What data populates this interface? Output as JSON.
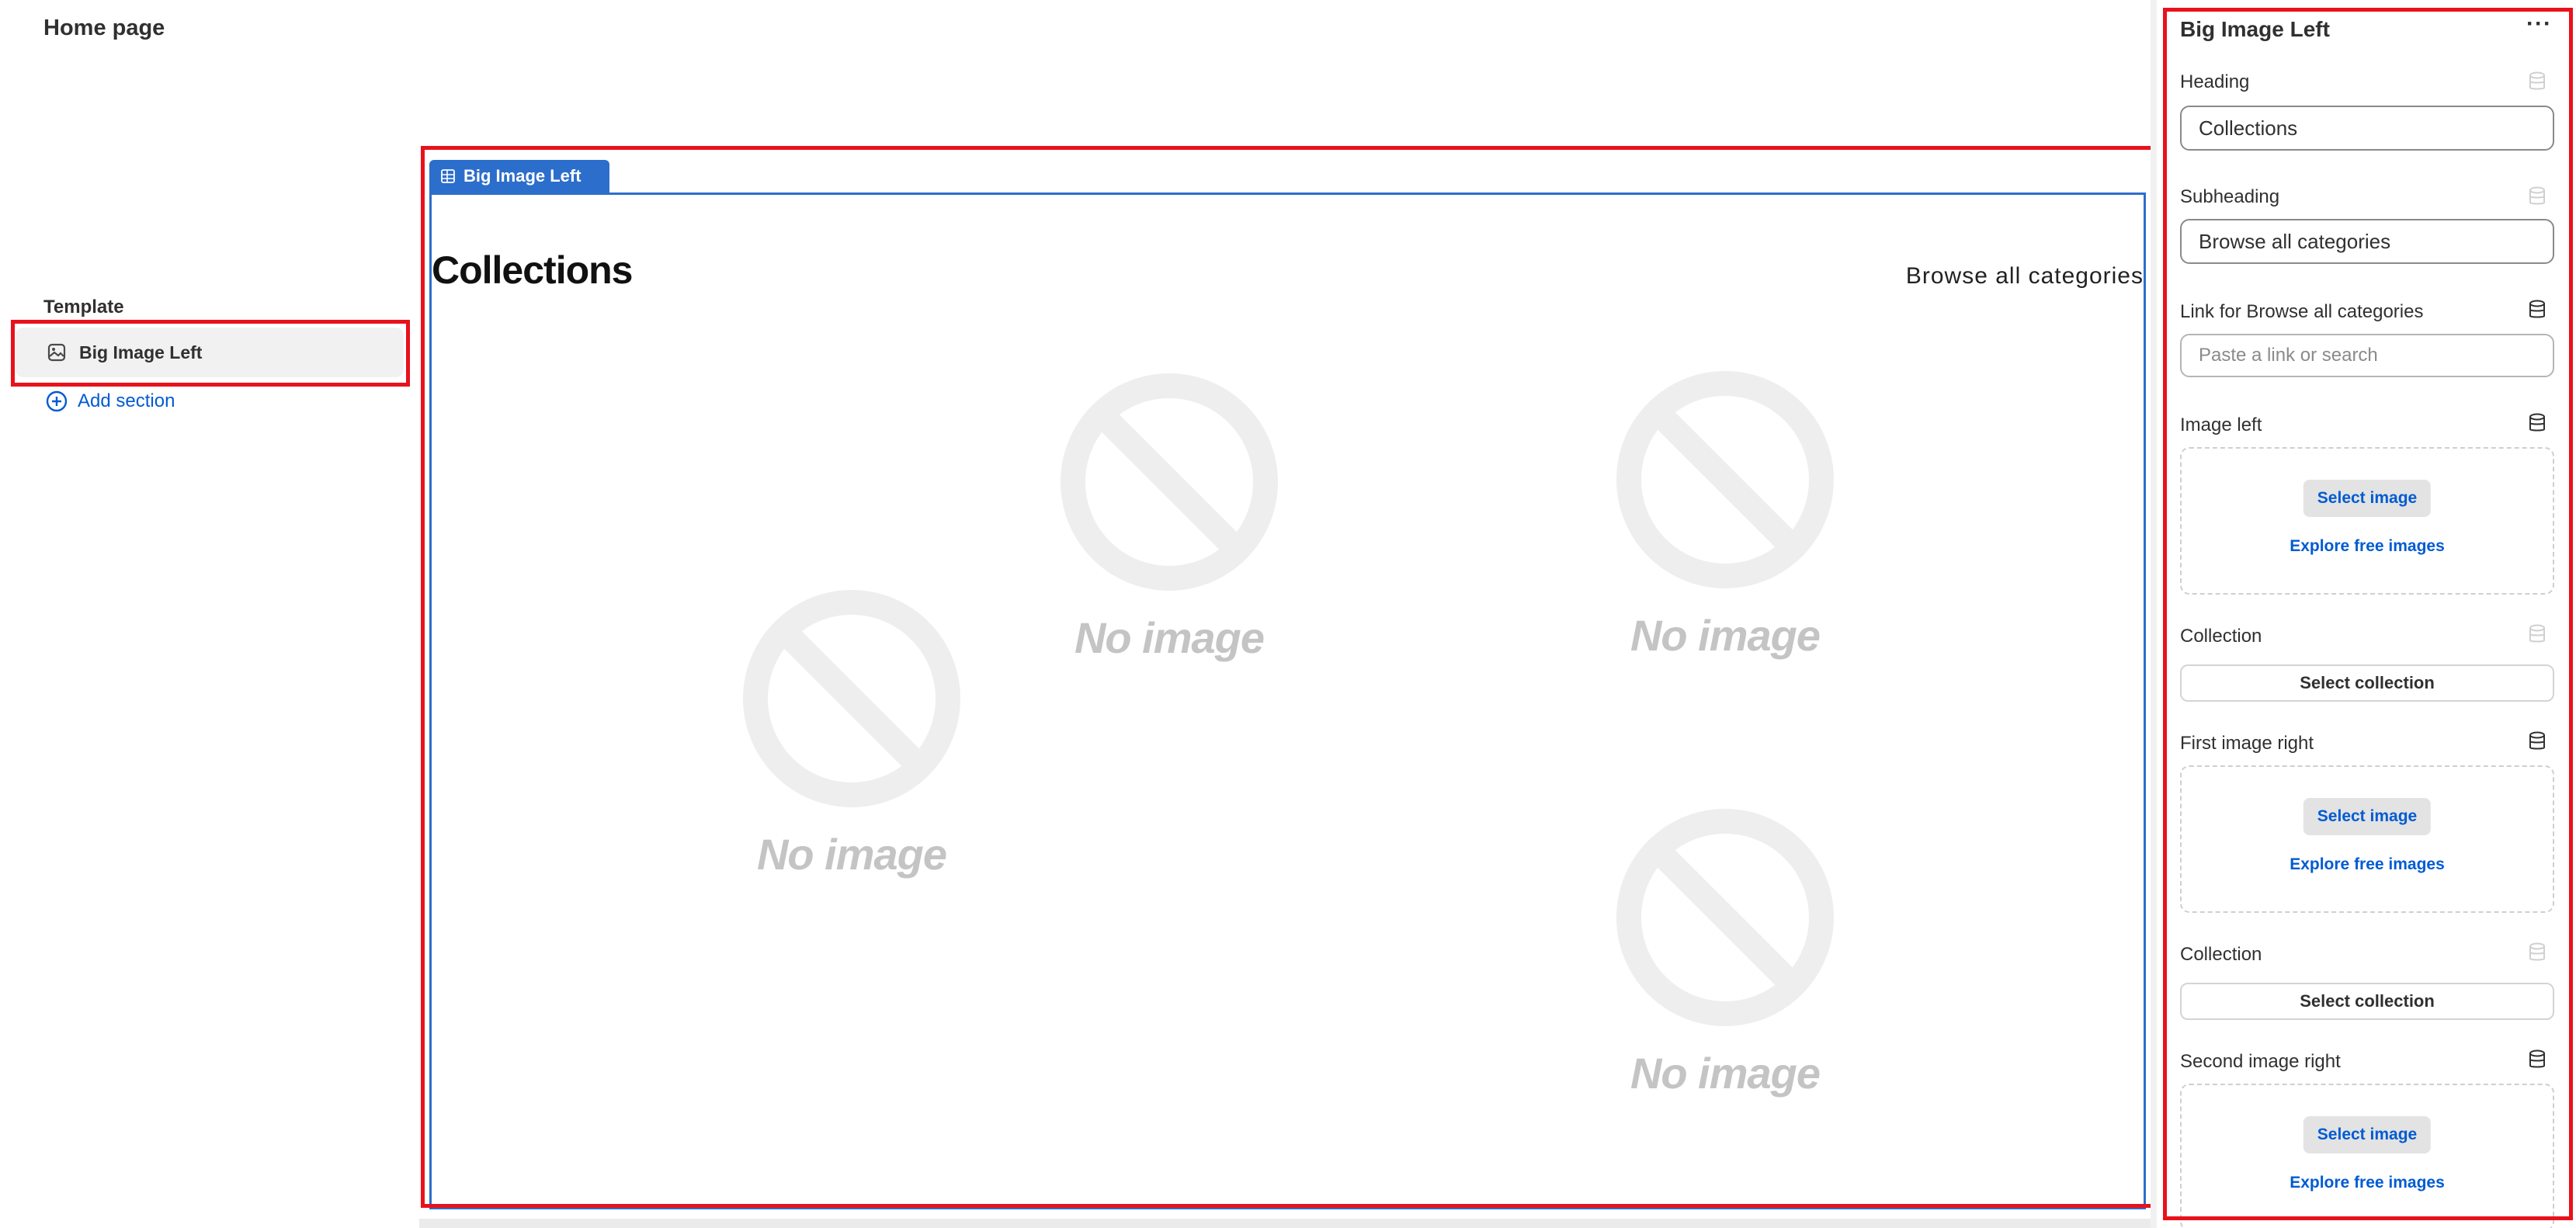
{
  "left_sidebar": {
    "page_title": "Home page",
    "template_label": "Template",
    "section_item_label": "Big Image Left",
    "add_section_label": "Add section"
  },
  "preview": {
    "section_tab_label": "Big Image Left",
    "heading": "Collections",
    "browse_link": "Browse all categories",
    "placeholders": [
      "No image",
      "No image",
      "No image"
    ]
  },
  "settings_panel": {
    "title": "Big Image Left",
    "more_label": "···",
    "heading_label": "Heading",
    "heading_value": "Collections",
    "subheading_label": "Subheading",
    "subheading_value": "Browse all categories",
    "link_label": "Link for Browse all categories",
    "link_placeholder": "Paste a link or search",
    "image_left_label": "Image left",
    "first_image_right_label": "First image right",
    "second_image_right_label": "Second image right",
    "collection_label": "Collection",
    "select_image_label": "Select image",
    "explore_free_images_label": "Explore free images",
    "select_collection_label": "Select collection"
  },
  "colors": {
    "accent": "#2c6ecb",
    "link": "#005bd3",
    "highlight": "#e8121c"
  }
}
